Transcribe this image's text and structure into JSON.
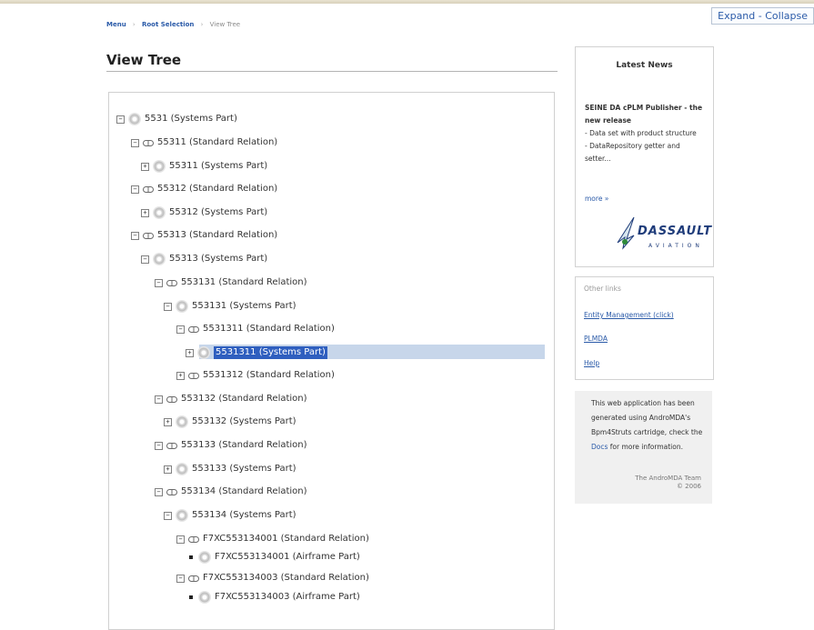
{
  "header": {
    "expand_label": "Expand",
    "separator": "-",
    "collapse_label": "Collapse"
  },
  "breadcrumb": [
    "Menu",
    "Root Selection",
    "View Tree"
  ],
  "page_title": "View Tree",
  "tree": [
    {
      "label": "5531 (Systems Part)",
      "toggle": "⊟",
      "icon": "gear-icon"
    },
    {
      "label": "55311 (Standard Relation)",
      "toggle": "⊟",
      "icon": "link-icon"
    },
    {
      "label": "55311 (Systems Part)",
      "toggle": "⊞",
      "icon": "gear-icon"
    },
    {
      "label": "55312 (Standard Relation)",
      "toggle": "⊟",
      "icon": "link-icon"
    },
    {
      "label": "55312 (Systems Part)",
      "toggle": "⊞",
      "icon": "gear-icon"
    },
    {
      "label": "55313 (Standard Relation)",
      "toggle": "⊟",
      "icon": "link-icon"
    },
    {
      "label": "55313 (Systems Part)",
      "toggle": "⊟",
      "icon": "gear-icon"
    },
    {
      "label": "553131 (Standard Relation)",
      "toggle": "⊟",
      "icon": "link-icon"
    },
    {
      "label": "553131 (Systems Part)",
      "toggle": "⊟",
      "icon": "gear-icon"
    },
    {
      "label": "5531311 (Standard Relation)",
      "toggle": "⊟",
      "icon": "link-icon"
    },
    {
      "label": "5531311 (Systems Part)",
      "toggle": "⊞",
      "icon": "gear-icon",
      "selected": true
    },
    {
      "label": "5531312 (Standard Relation)",
      "toggle": "⊞",
      "icon": "link-icon"
    },
    {
      "label": "553132 (Standard Relation)",
      "toggle": "⊟",
      "icon": "link-icon"
    },
    {
      "label": "553132 (Systems Part)",
      "toggle": "⊞",
      "icon": "gear-icon"
    },
    {
      "label": "553133 (Standard Relation)",
      "toggle": "⊟",
      "icon": "link-icon"
    },
    {
      "label": "553133 (Systems Part)",
      "toggle": "⊞",
      "icon": "gear-icon"
    },
    {
      "label": "553134 (Standard Relation)",
      "toggle": "⊟",
      "icon": "link-icon"
    },
    {
      "label": "553134 (Systems Part)",
      "toggle": "⊟",
      "icon": "gear-icon"
    },
    {
      "label": "F7XC553134001 (Standard Relation)",
      "toggle": "⊟",
      "icon": "link-icon"
    },
    {
      "label": "F7XC553134001 (Airframe Part)",
      "toggle": "■",
      "icon": "gear-icon"
    },
    {
      "label": "F7XC553134003 (Standard Relation)",
      "toggle": "⊟",
      "icon": "link-icon"
    },
    {
      "label": "F7XC553134003 (Airframe Part)",
      "toggle": "■",
      "icon": "gear-icon"
    }
  ],
  "news": {
    "heading": "Latest News",
    "item_title": "SEINE DA cPLM Publisher - the new release",
    "bullets": [
      "- Data set with product structure",
      "- DataRepository getter and setter..."
    ],
    "more": "more »",
    "logo_word": "DASSAULT",
    "logo_sub": "AVIATION"
  },
  "other_links": {
    "heading": "Other links",
    "links": [
      "Entity Management (click)",
      "PLMDA",
      "Help"
    ]
  },
  "info": {
    "text_before": "This web application has been generated using AndroMDA's Bpm4Struts cartridge, check the ",
    "docs_link": "Docs",
    "text_after": " for more information.",
    "team": "The AndroMDA Team",
    "year": "© 2006"
  },
  "colors": {
    "link": "#2a5aa8",
    "selection": "#2f5fbf",
    "selection_row": "#c7d6ea"
  }
}
